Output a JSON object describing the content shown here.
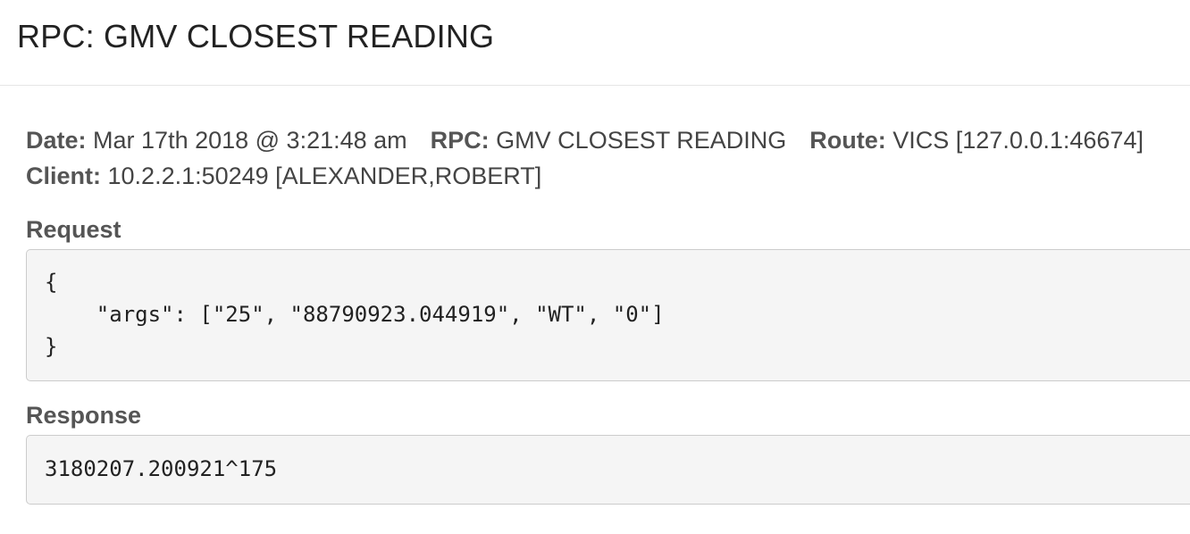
{
  "header": {
    "title": "RPC: GMV CLOSEST READING"
  },
  "meta": {
    "date_key": "Date:",
    "date_value": "Mar 17th 2018 @ 3:21:48 am",
    "rpc_key": "RPC:",
    "rpc_value": "GMV CLOSEST READING",
    "route_key": "Route:",
    "route_value": "VICS [127.0.0.1:46674]",
    "client_key": "Client:",
    "client_value": "10.2.2.1:50249 [ALEXANDER,ROBERT]"
  },
  "request": {
    "label": "Request",
    "body": "{\n    \"args\": [\"25\", \"88790923.044919\", \"WT\", \"0\"]\n}"
  },
  "response": {
    "label": "Response",
    "body": "3180207.200921^175"
  }
}
